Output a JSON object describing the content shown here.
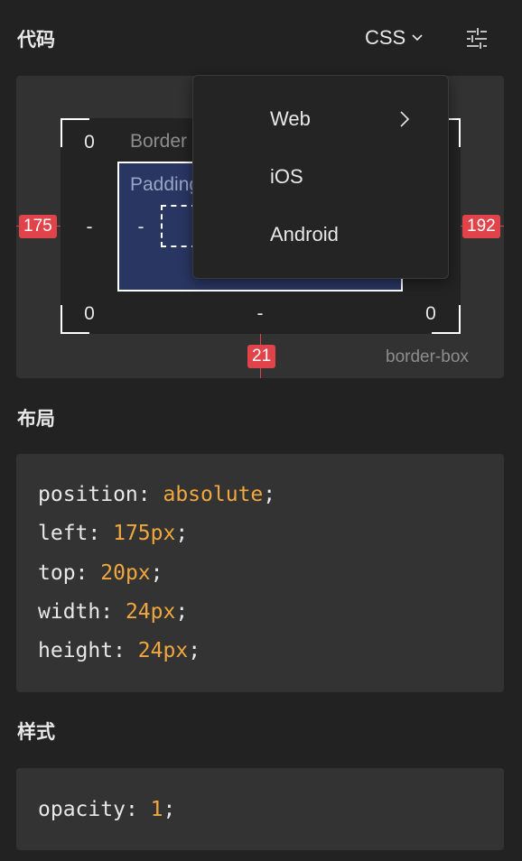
{
  "sections": {
    "code_title": "代码",
    "layout_title": "布局",
    "style_title": "样式"
  },
  "toolbar": {
    "language": "CSS",
    "language_dropdown_icon": "chevron-down-icon",
    "settings_icon": "sliders-icon"
  },
  "dropdown": {
    "items": [
      {
        "label": "Web",
        "has_submenu": true
      },
      {
        "label": "iOS",
        "has_submenu": false
      },
      {
        "label": "Android",
        "has_submenu": false
      }
    ]
  },
  "box_model": {
    "border_label": "Border",
    "padding_label": "Padding",
    "border_top_left": "0",
    "border_left": "-",
    "border_bottom_left": "0",
    "border_bottom": "-",
    "border_bottom_right": "0",
    "padding_left": "-",
    "offset_left": "175",
    "offset_right": "192",
    "offset_bottom": "21",
    "box_sizing": "border-box",
    "colors": {
      "padding_fill": "#2a3662",
      "measure_red": "#e0434a"
    }
  },
  "layout_code": [
    {
      "prop": "position",
      "value": "absolute"
    },
    {
      "prop": "left",
      "value": "175px"
    },
    {
      "prop": "top",
      "value": "20px"
    },
    {
      "prop": "width",
      "value": "24px"
    },
    {
      "prop": "height",
      "value": "24px"
    }
  ],
  "style_code": [
    {
      "prop": "opacity",
      "value": "1"
    }
  ],
  "colors": {
    "background": "#222222",
    "panel": "#333333",
    "value_orange": "#f0a83e"
  }
}
